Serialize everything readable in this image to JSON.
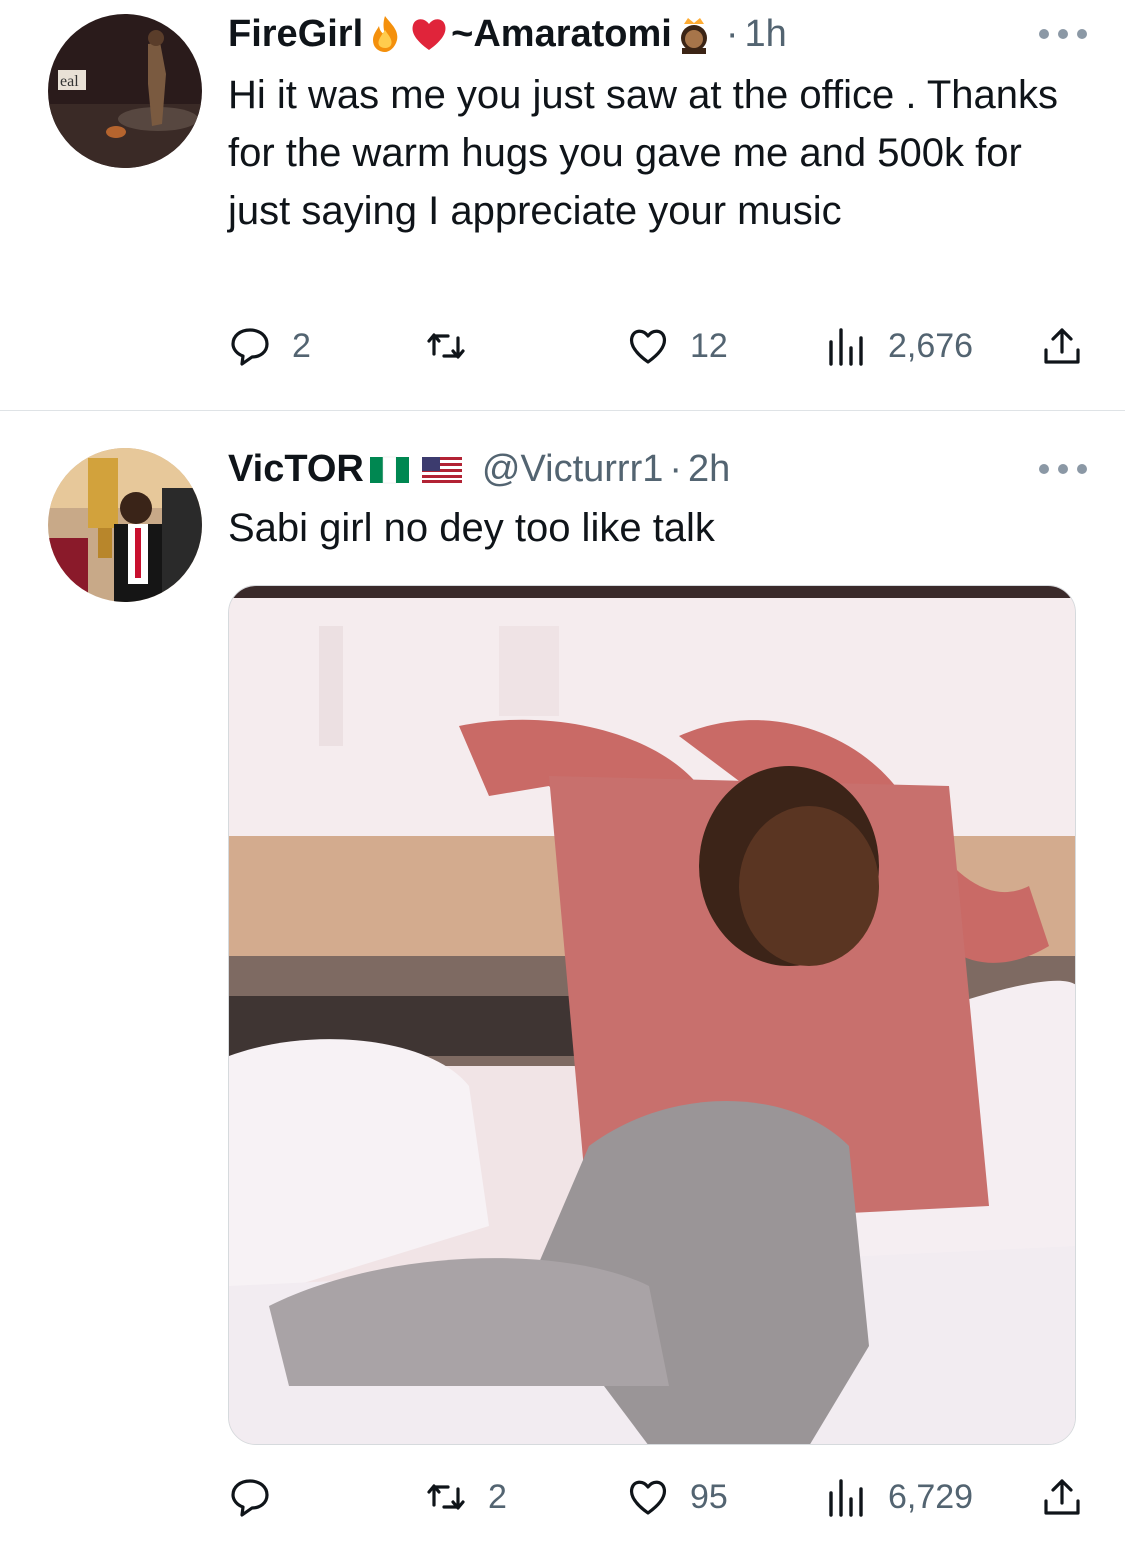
{
  "tweets": [
    {
      "display_name": "FireGirl",
      "display_name_suffix": "~Amaratomi",
      "name_emojis": [
        "fire-emoji",
        "red-heart-emoji",
        "princess-emoji"
      ],
      "dot": "·",
      "time": "1h",
      "text": "Hi it was me you just saw at the office  . Thanks for the warm hugs you gave me and 500k for just saying I appreciate your music",
      "replies": "2",
      "retweets": "",
      "likes": "12",
      "views": "2,676"
    },
    {
      "display_name": "VicTOR",
      "name_emojis": [
        "nigeria-flag-emoji",
        "usa-flag-emoji"
      ],
      "handle": "@Victurrr1",
      "dot": "·",
      "time": "2h",
      "text": "Sabi girl no dey too like talk",
      "replies": "",
      "retweets": "2",
      "likes": "95",
      "views": "6,729"
    }
  ],
  "icons": {
    "reply": "reply-icon",
    "retweet": "retweet-icon",
    "like": "heart-icon",
    "views": "views-icon",
    "share": "share-icon",
    "more": "more-icon"
  },
  "colors": {
    "text": "#0f1419",
    "secondary": "#536471",
    "divider": "#dfe3e6",
    "heart": "#e0243a",
    "nigeria_green": "#008751"
  }
}
